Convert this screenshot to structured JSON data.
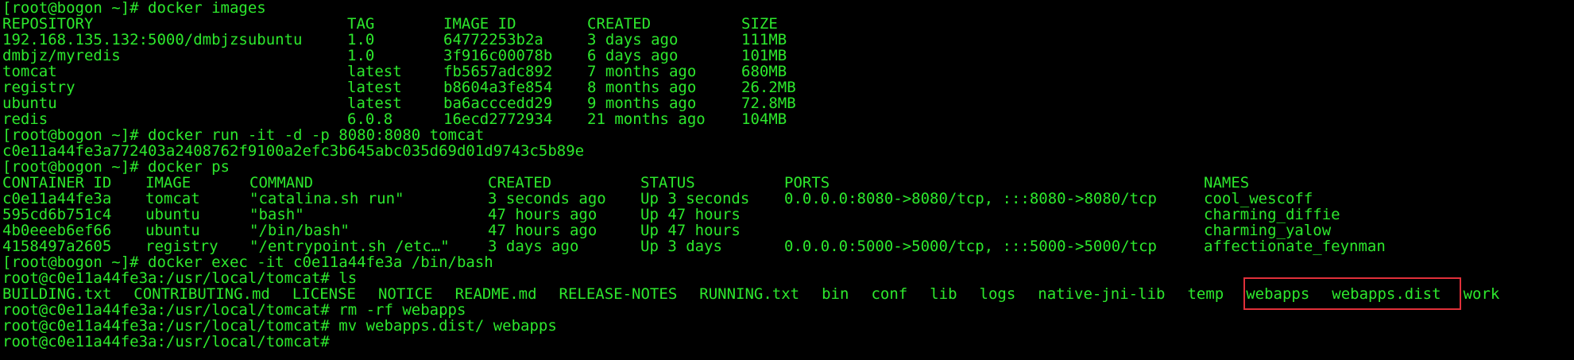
{
  "prompt": "[root@bogon ~]# ",
  "container_prompt": "root@c0e11a44fe3a:/usr/local/tomcat# ",
  "commands": {
    "images": "docker images",
    "run": "docker run -it -d -p 8080:8080 tomcat",
    "ps": "docker ps",
    "exec": "docker exec -it c0e11a44fe3a /bin/bash",
    "ls": "ls",
    "rm": "rm -rf webapps",
    "mv": "mv webapps.dist/ webapps"
  },
  "images_table": {
    "headers": [
      "REPOSITORY",
      "TAG",
      "IMAGE ID",
      "CREATED",
      "SIZE"
    ],
    "rows": [
      [
        "192.168.135.132:5000/dmbjzsubuntu",
        "1.0",
        "64772253b2a",
        "3 days ago",
        "111MB"
      ],
      [
        "dmbjz/myredis",
        "1.0",
        "3f916c00078b",
        "6 days ago",
        "101MB"
      ],
      [
        "tomcat",
        "latest",
        "fb5657adc892",
        "7 months ago",
        "680MB"
      ],
      [
        "registry",
        "latest",
        "b8604a3fe854",
        "8 months ago",
        "26.2MB"
      ],
      [
        "ubuntu",
        "latest",
        "ba6acccedd29",
        "9 months ago",
        "72.8MB"
      ],
      [
        "redis",
        "6.0.8",
        "16ecd2772934",
        "21 months ago",
        "104MB"
      ]
    ]
  },
  "run_output": "c0e11a44fe3a772403a2408762f9100a2efc3b645abc035d69d01d9743c5b89e",
  "ps_table": {
    "headers": [
      "CONTAINER ID",
      "IMAGE",
      "COMMAND",
      "CREATED",
      "STATUS",
      "PORTS",
      "NAMES"
    ],
    "rows": [
      [
        "c0e11a44fe3a",
        "tomcat",
        "\"catalina.sh run\"",
        "3 seconds ago",
        "Up 3 seconds",
        "0.0.0.0:8080->8080/tcp, :::8080->8080/tcp",
        "cool_wescoff"
      ],
      [
        "595cd6b751c4",
        "ubuntu",
        "\"bash\"",
        "47 hours ago",
        "Up 47 hours",
        "",
        "charming_diffie"
      ],
      [
        "4b0eeeb6ef66",
        "ubuntu",
        "\"/bin/bash\"",
        "47 hours ago",
        "Up 47 hours",
        "",
        "charming_yalow"
      ],
      [
        "4158497a2605",
        "registry",
        "\"/entrypoint.sh /etc…\"",
        "3 days ago",
        "Up 3 days",
        "0.0.0.0:5000->5000/tcp, :::5000->5000/tcp",
        "affectionate_feynman"
      ]
    ]
  },
  "ls_output": [
    "BUILDING.txt",
    "CONTRIBUTING.md",
    "LICENSE",
    "NOTICE",
    "README.md",
    "RELEASE-NOTES",
    "RUNNING.txt",
    "bin",
    "conf",
    "lib",
    "logs",
    "native-jni-lib",
    "temp",
    "webapps",
    "webapps.dist",
    "work"
  ],
  "colors": {
    "background": "#000000",
    "text": "#2de82d",
    "highlight_border": "#e0303a"
  }
}
